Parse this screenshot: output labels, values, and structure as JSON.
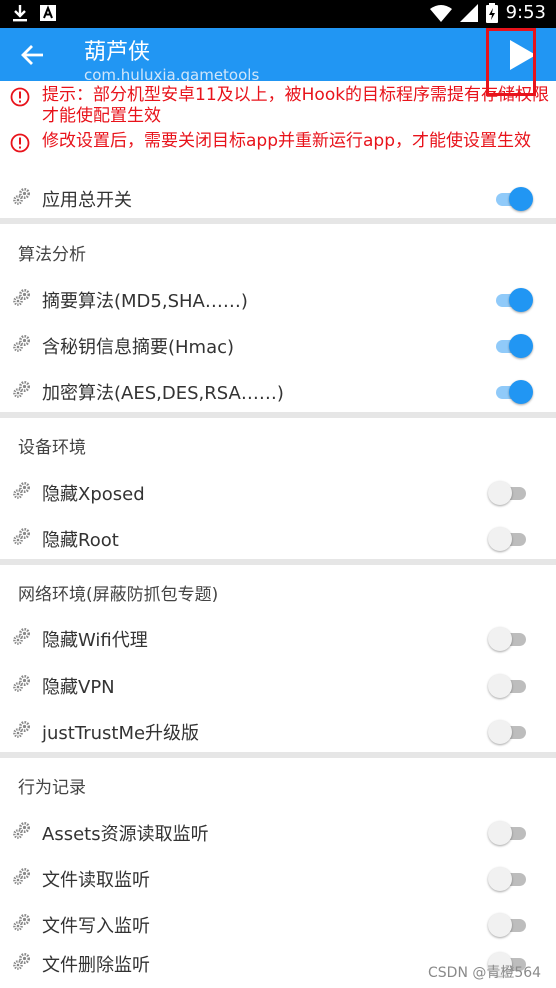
{
  "status_bar": {
    "time": "9:53"
  },
  "app_bar": {
    "title": "葫芦侠",
    "subtitle": "com.huluxia.gametools"
  },
  "warnings": [
    "提示：部分机型安卓11及以上，被Hook的目标程序需提有存储权限才能使配置生效",
    "修改设置后，需要关闭目标app并重新运行app，才能使设置生效"
  ],
  "master_switch": {
    "label": "应用总开关",
    "on": true
  },
  "sections": [
    {
      "title": "算法分析",
      "items": [
        {
          "label": "摘要算法(MD5,SHA……)",
          "on": true
        },
        {
          "label": "含秘钥信息摘要(Hmac)",
          "on": true
        },
        {
          "label": "加密算法(AES,DES,RSA……)",
          "on": true
        }
      ]
    },
    {
      "title": "设备环境",
      "items": [
        {
          "label": "隐藏Xposed",
          "on": false
        },
        {
          "label": "隐藏Root",
          "on": false
        }
      ]
    },
    {
      "title": "网络环境(屏蔽防抓包专题)",
      "items": [
        {
          "label": "隐藏Wifi代理",
          "on": false
        },
        {
          "label": "隐藏VPN",
          "on": false
        },
        {
          "label": "justTrustMe升级版",
          "on": false
        }
      ]
    },
    {
      "title": "行为记录",
      "items": [
        {
          "label": "Assets资源读取监听",
          "on": false
        },
        {
          "label": "文件读取监听",
          "on": false
        },
        {
          "label": "文件写入监听",
          "on": false
        },
        {
          "label": "文件删除监听",
          "on": false
        }
      ]
    }
  ],
  "watermark": "CSDN @青橙564",
  "colors": {
    "accent": "#2196f3",
    "warning": "#e8131b",
    "status_bar": "#000000"
  }
}
